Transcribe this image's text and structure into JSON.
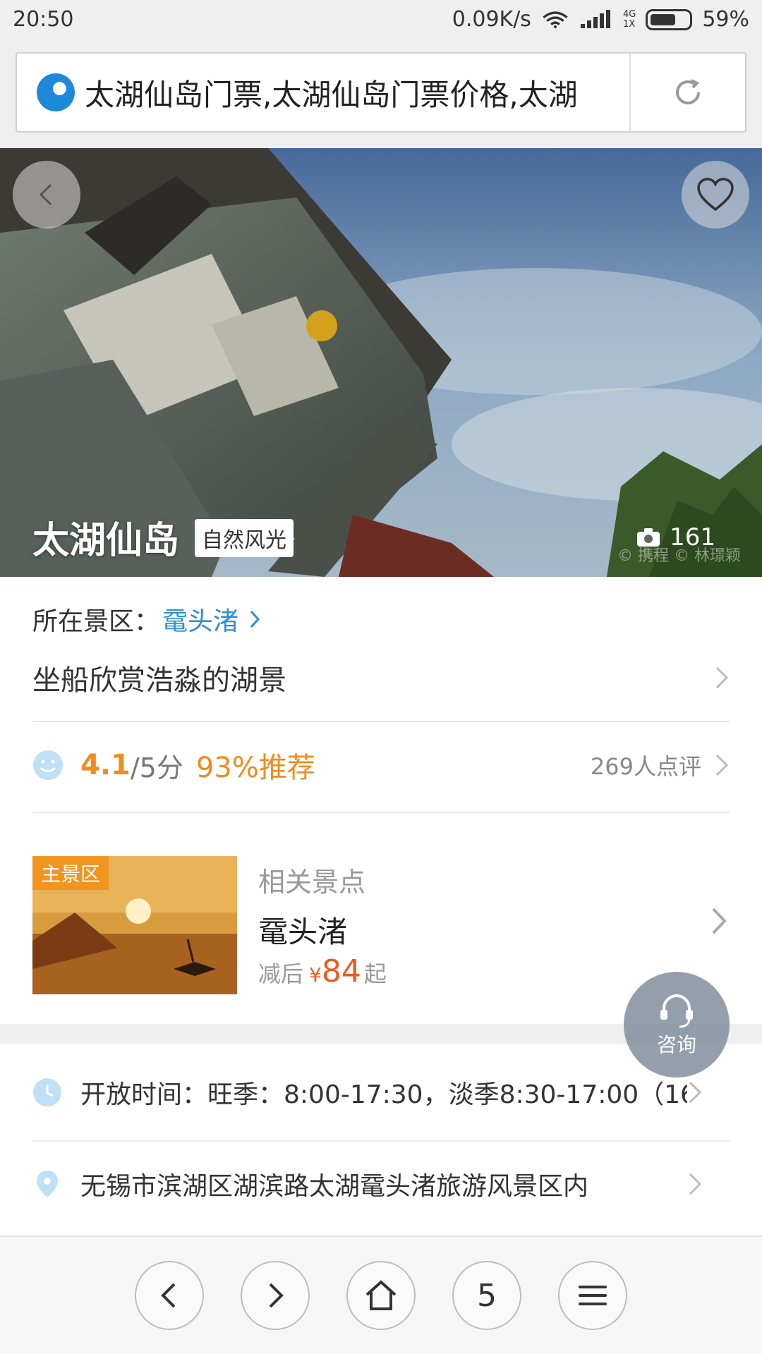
{
  "status_bar": {
    "time": "20:50",
    "speed": "0.09K/s",
    "network_top": "4G",
    "network_bottom": "1X",
    "battery": "59%"
  },
  "url_bar": {
    "title": "太湖仙岛门票,太湖仙岛门票价格,太湖",
    "reload_icon": "reload-icon"
  },
  "hero": {
    "title": "太湖仙岛",
    "tag": "自然风光",
    "photo_count": "161",
    "watermark": "© 携程 © 林璟颖"
  },
  "info": {
    "scenic_label": "所在景区：",
    "scenic_name": "鼋头渚",
    "description": "坐船欣赏浩淼的湖景",
    "rating": "4.1",
    "rating_max": "/5分",
    "recommend": "93%推荐",
    "review_count": "269人点评"
  },
  "related": {
    "badge": "主景区",
    "label": "相关景点",
    "name": "鼋头渚",
    "price_prefix": "减后",
    "price_symbol": "¥",
    "price_value": "84",
    "price_suffix": "起"
  },
  "consult": {
    "label": "咨询"
  },
  "details": {
    "hours": "开放时间：旺季：8:00-17:30，淡季8:30-17:00（16...",
    "address": "无锡市滨湖区湖滨路太湖鼋头渚旅游风景区内"
  },
  "bottom_nav": {
    "tabs_count": "5"
  },
  "colors": {
    "accent_orange": "#f08b1e",
    "link_blue": "#2a8fd6",
    "price_red": "#f05a1e"
  }
}
